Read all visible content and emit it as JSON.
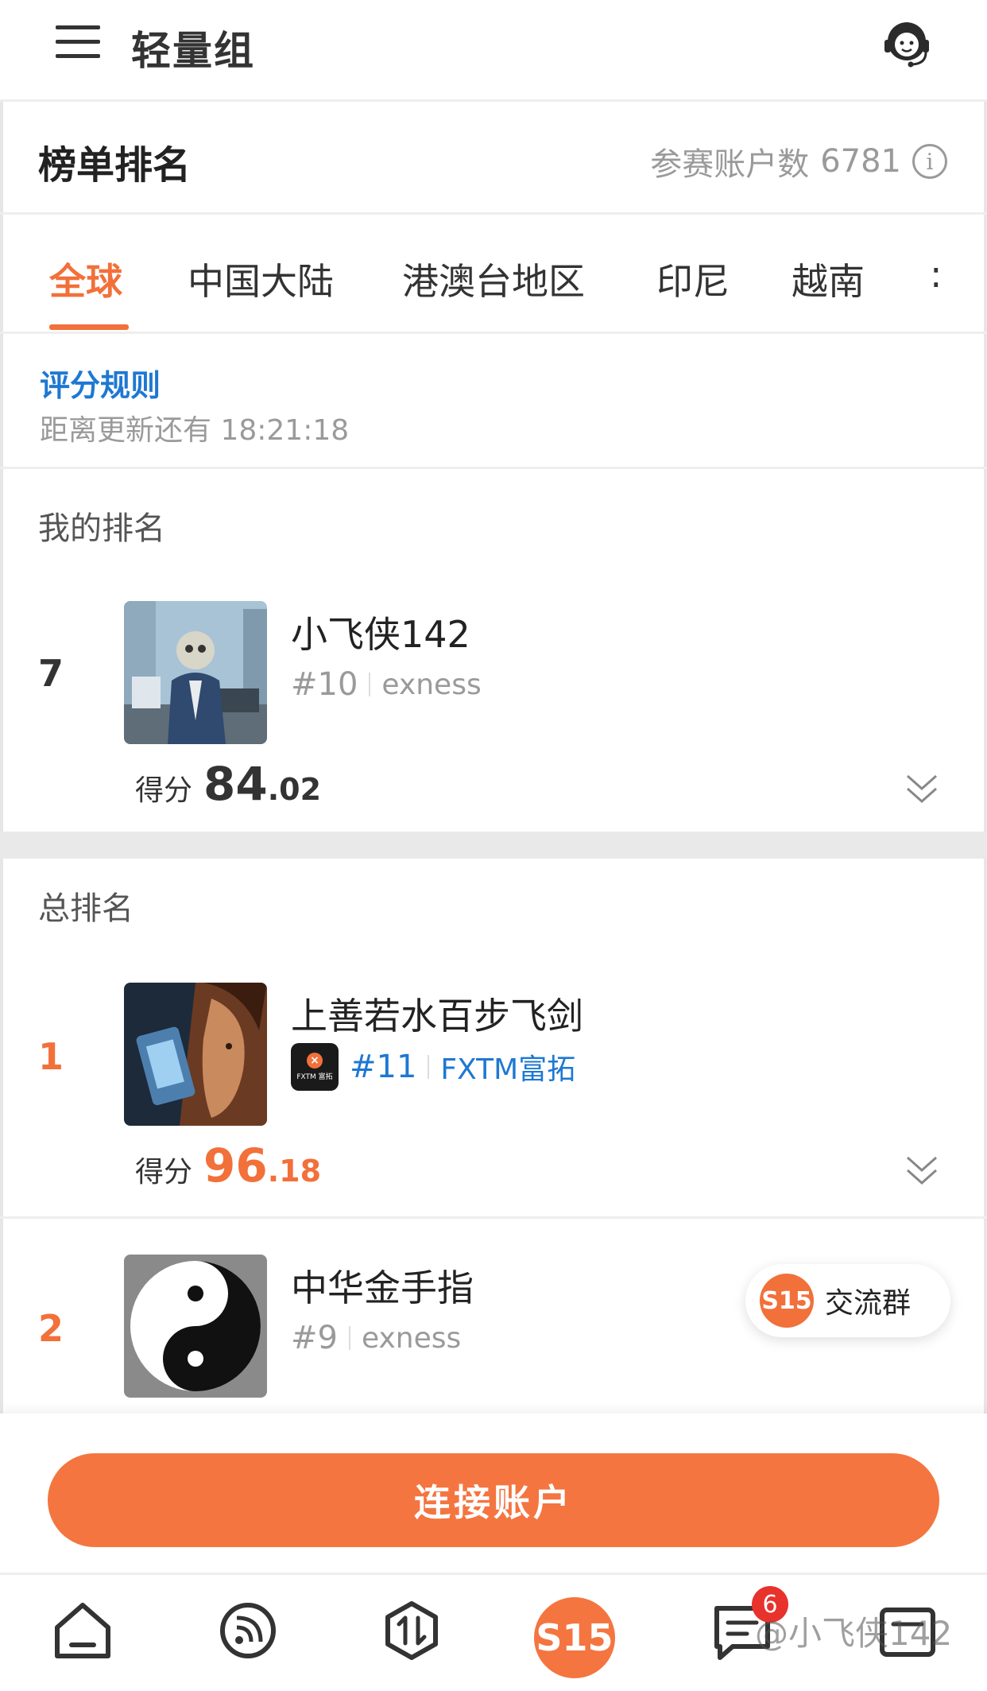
{
  "header": {
    "title": "轻量组"
  },
  "ranking": {
    "title": "榜单排名",
    "participants_label": "参赛账户数",
    "participants_count": "6781"
  },
  "tabs": [
    "全球",
    "中国大陆",
    "港澳台地区",
    "印尼",
    "越南"
  ],
  "tab_more": ":",
  "rules": {
    "link": "评分规则",
    "countdown": "距离更新还有 18:21:18"
  },
  "my_rank": {
    "label": "我的排名",
    "rank": "7",
    "name": "小飞侠142",
    "number": "#10",
    "broker": "exness",
    "score_label": "得分",
    "score_int": "84",
    "score_dec": ".02"
  },
  "overall": {
    "label": "总排名",
    "rows": [
      {
        "rank": "1",
        "name": "上善若水百步飞剑",
        "number": "#11",
        "broker": "FXTM富拓",
        "broker_logo_text": "FXTM 富拓",
        "score_label": "得分",
        "score_int": "96",
        "score_dec": ".18"
      },
      {
        "rank": "2",
        "name": "中华金手指",
        "number": "#9",
        "broker": "exness"
      }
    ]
  },
  "chat_group": {
    "badge": "S15",
    "label": "交流群"
  },
  "connect_button": "连接账户",
  "bottom_nav": {
    "center": "S15",
    "messages_badge": "6",
    "watermark": "@小飞侠142"
  },
  "colors": {
    "accent": "#f2703a",
    "link": "#1e78d2",
    "muted": "#9a9a9a"
  }
}
